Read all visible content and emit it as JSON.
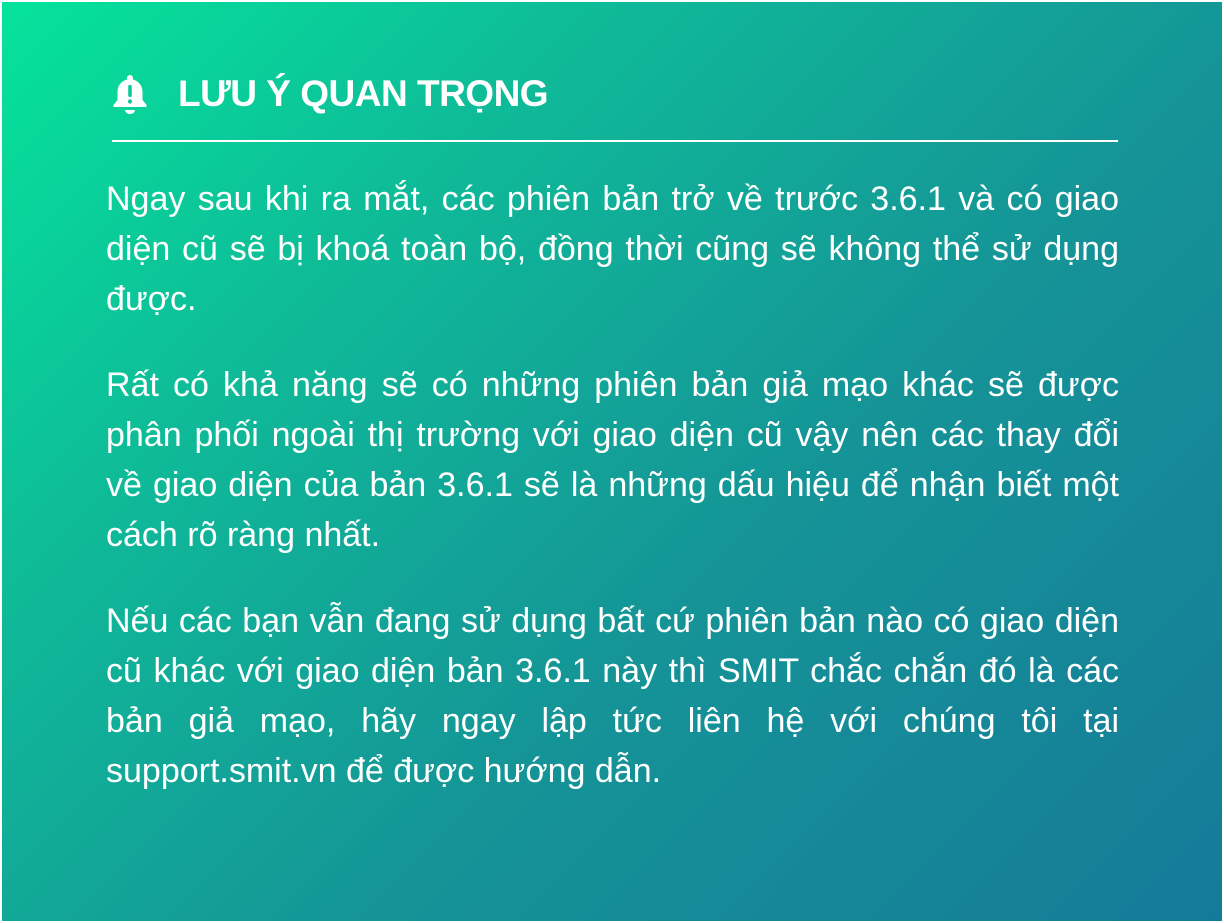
{
  "notice": {
    "icon": "bell-icon",
    "title": "LƯU Ý QUAN TRỌNG",
    "paragraphs": [
      "Ngay sau khi ra mắt, các phiên bản trở về trước 3.6.1 và có giao diện cũ sẽ bị khoá toàn bộ, đồng thời cũng sẽ không thể sử dụng được.",
      "Rất có khả năng sẽ có những phiên bản giả mạo khác sẽ được phân phối ngoài thị trường với giao diện cũ vậy nên các thay đổi về giao diện của bản 3.6.1 sẽ là những dấu hiệu để nhận biết một cách rõ ràng nhất.",
      "Nếu các bạn vẫn đang sử dụng bất cứ phiên bản nào có giao diện cũ khác với giao diện bản 3.6.1 này thì SMIT chắc chắn đó là các bản giả mạo, hãy ngay lập tức liên hệ với chúng tôi tại support.smit.vn để được hướng dẫn."
    ]
  },
  "colors": {
    "gradient_start": "#05e39b",
    "gradient_end": "#157a99",
    "text": "#ffffff"
  }
}
